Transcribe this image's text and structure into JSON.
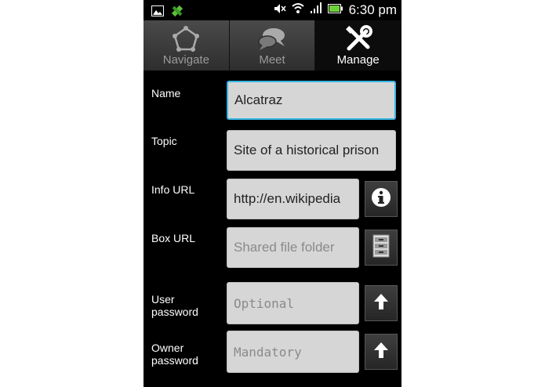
{
  "status_bar": {
    "time": "6:30 pm",
    "icons": [
      "image-icon",
      "gps-icon",
      "mute-icon",
      "wifi-icon",
      "signal-icon",
      "battery-icon"
    ]
  },
  "tabs": [
    {
      "label": "Navigate",
      "icon": "pentagon-icon",
      "active": false
    },
    {
      "label": "Meet",
      "icon": "chat-bubbles-icon",
      "active": false
    },
    {
      "label": "Manage",
      "icon": "tools-icon",
      "active": true
    }
  ],
  "form": {
    "name": {
      "label": "Name",
      "value": "Alcatraz"
    },
    "topic": {
      "label": "Topic",
      "value": "Site of a historical prison"
    },
    "info_url": {
      "label": "Info URL",
      "value": "http://en.wikipedia"
    },
    "box_url": {
      "label": "Box URL",
      "placeholder": "Shared file folder"
    },
    "user_password": {
      "label_line1": "User",
      "label_line2": "password",
      "placeholder": "Optional"
    },
    "owner_password": {
      "label_line1": "Owner",
      "label_line2": "password",
      "placeholder": "Mandatory"
    }
  },
  "colors": {
    "focus": "#33b5e5",
    "background": "#000000",
    "field": "#d6d6d6"
  }
}
